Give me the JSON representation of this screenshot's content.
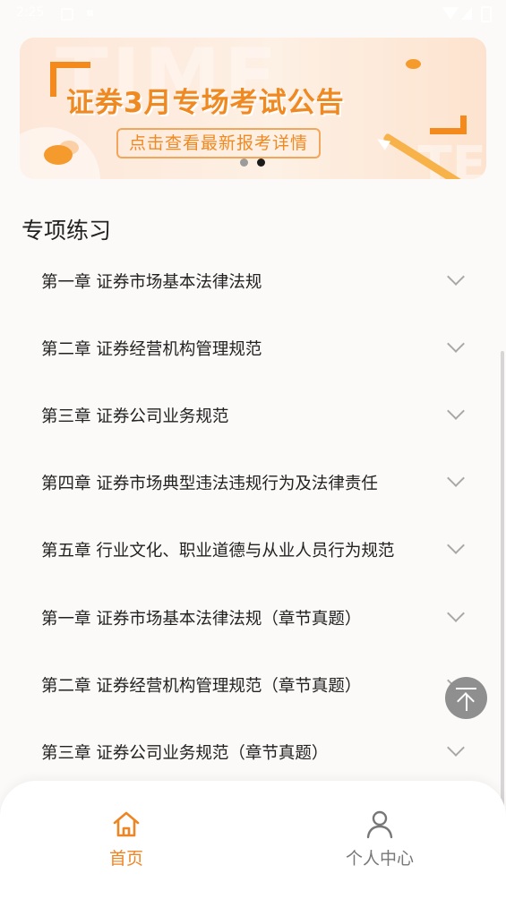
{
  "status_bar": {
    "time": "2:25",
    "icon_1": "notification-square-icon",
    "icon_2": "sim-icon",
    "icon_right": [
      "wifi-icon",
      "signal-icon",
      "battery-icon"
    ]
  },
  "banner": {
    "headline": "证券3月专场考试公告",
    "subtitle": "点击查看最新报考详情",
    "bg_word_1": "TIME",
    "bg_word_2": "TE",
    "slide_count": 2,
    "active_slide": 2
  },
  "section": {
    "title": "专项练习"
  },
  "chapters": [
    {
      "label": "第一章 证券市场基本法律法规"
    },
    {
      "label": "第二章 证券经营机构管理规范"
    },
    {
      "label": "第三章 证券公司业务规范"
    },
    {
      "label": "第四章 证券市场典型违法违规行为及法律责任"
    },
    {
      "label": "第五章 行业文化、职业道德与从业人员行为规范"
    },
    {
      "label": "第一章 证券市场基本法律法规（章节真题）"
    },
    {
      "label": "第二章 证券经营机构管理规范（章节真题）"
    },
    {
      "label": "第三章 证券公司业务规范（章节真题）"
    }
  ],
  "back_to_top": {
    "icon": "back-to-top-icon"
  },
  "tabbar": {
    "home_label": "首页",
    "profile_label": "个人中心",
    "home_icon": "home-icon",
    "profile_icon": "person-icon",
    "active": "home"
  },
  "colors": {
    "accent": "#ef8522",
    "banner_text": "#ef8a23",
    "chevron": "#a8a8a8",
    "inactive_tab": "#777777"
  }
}
